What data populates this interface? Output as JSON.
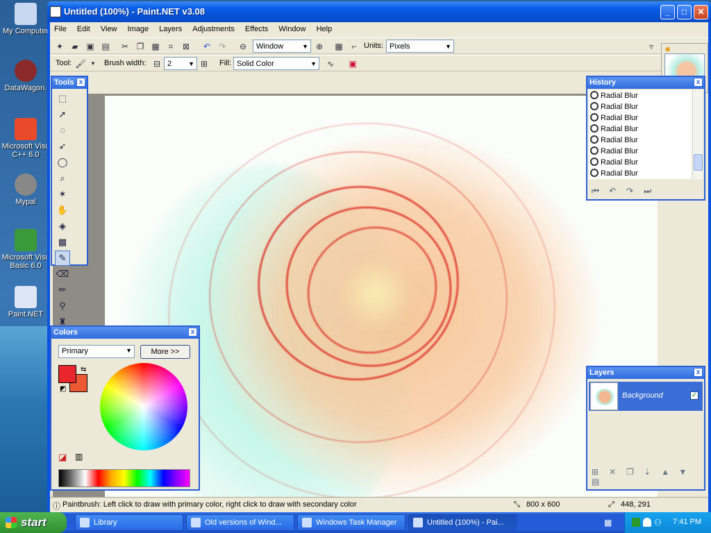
{
  "desktop": {
    "icons": [
      {
        "label": "My Computer",
        "icon": "computer-icon",
        "color": "#c9d8f0"
      },
      {
        "label": "DataWagon.",
        "icon": "datawagon-icon",
        "color": "#8b2a2a"
      },
      {
        "label": "Microsoft Visu C++ 6.0",
        "icon": "vcpp-icon",
        "color": "#e84a2a"
      },
      {
        "label": "Mypal",
        "icon": "raccoon-icon",
        "color": "#888888"
      },
      {
        "label": "Microsoft Visu Basic 6.0",
        "icon": "vb-icon",
        "color": "#3a9a3a"
      },
      {
        "label": "Paint.NET",
        "icon": "paintnet-icon",
        "color": "#dde6f5"
      }
    ]
  },
  "window": {
    "title": "Untitled (100%) - Paint.NET v3.08",
    "minimize": "_",
    "maximize": "□",
    "close": "✕"
  },
  "menu": [
    "File",
    "Edit",
    "View",
    "Image",
    "Layers",
    "Adjustments",
    "Effects",
    "Window",
    "Help"
  ],
  "toolbar": {
    "zoom_value": "Window",
    "units_label": "Units:",
    "units_value": "Pixels",
    "tool_label": "Tool:",
    "brush_width_label": "Brush width:",
    "brush_width_value": "2",
    "fill_label": "Fill:",
    "fill_value": "Solid Color",
    "minus": "⊟",
    "plus": "⊞"
  },
  "tools_panel": {
    "title": "Tools",
    "close": "x"
  },
  "history": {
    "title": "History",
    "close": "x",
    "items": [
      "Radial Blur",
      "Radial Blur",
      "Radial Blur",
      "Radial Blur",
      "Radial Blur",
      "Radial Blur",
      "Radial Blur",
      "Radial Blur",
      "Radial Blur"
    ]
  },
  "layers": {
    "title": "Layers",
    "close": "x",
    "layer_name": "Background",
    "check": "✓"
  },
  "colors": {
    "title": "Colors",
    "close": "x",
    "mode": "Primary",
    "more_button": "More >>",
    "primary_color": "#e8262b",
    "secondary_color": "#ec5a34"
  },
  "status": {
    "hint": "Paintbrush: Left click to draw with primary color, right click to draw with secondary color",
    "image_size": "800 x 600",
    "cursor_pos": "448, 291"
  },
  "taskbar": {
    "start": "start",
    "tasks": [
      {
        "label": "Library",
        "active": false
      },
      {
        "label": "Old versions of Wind...",
        "active": false
      },
      {
        "label": "Windows Task Manager",
        "active": false
      },
      {
        "label": "Untitled (100%) - Pai...",
        "active": true
      }
    ],
    "clock": "7:41 PM"
  }
}
